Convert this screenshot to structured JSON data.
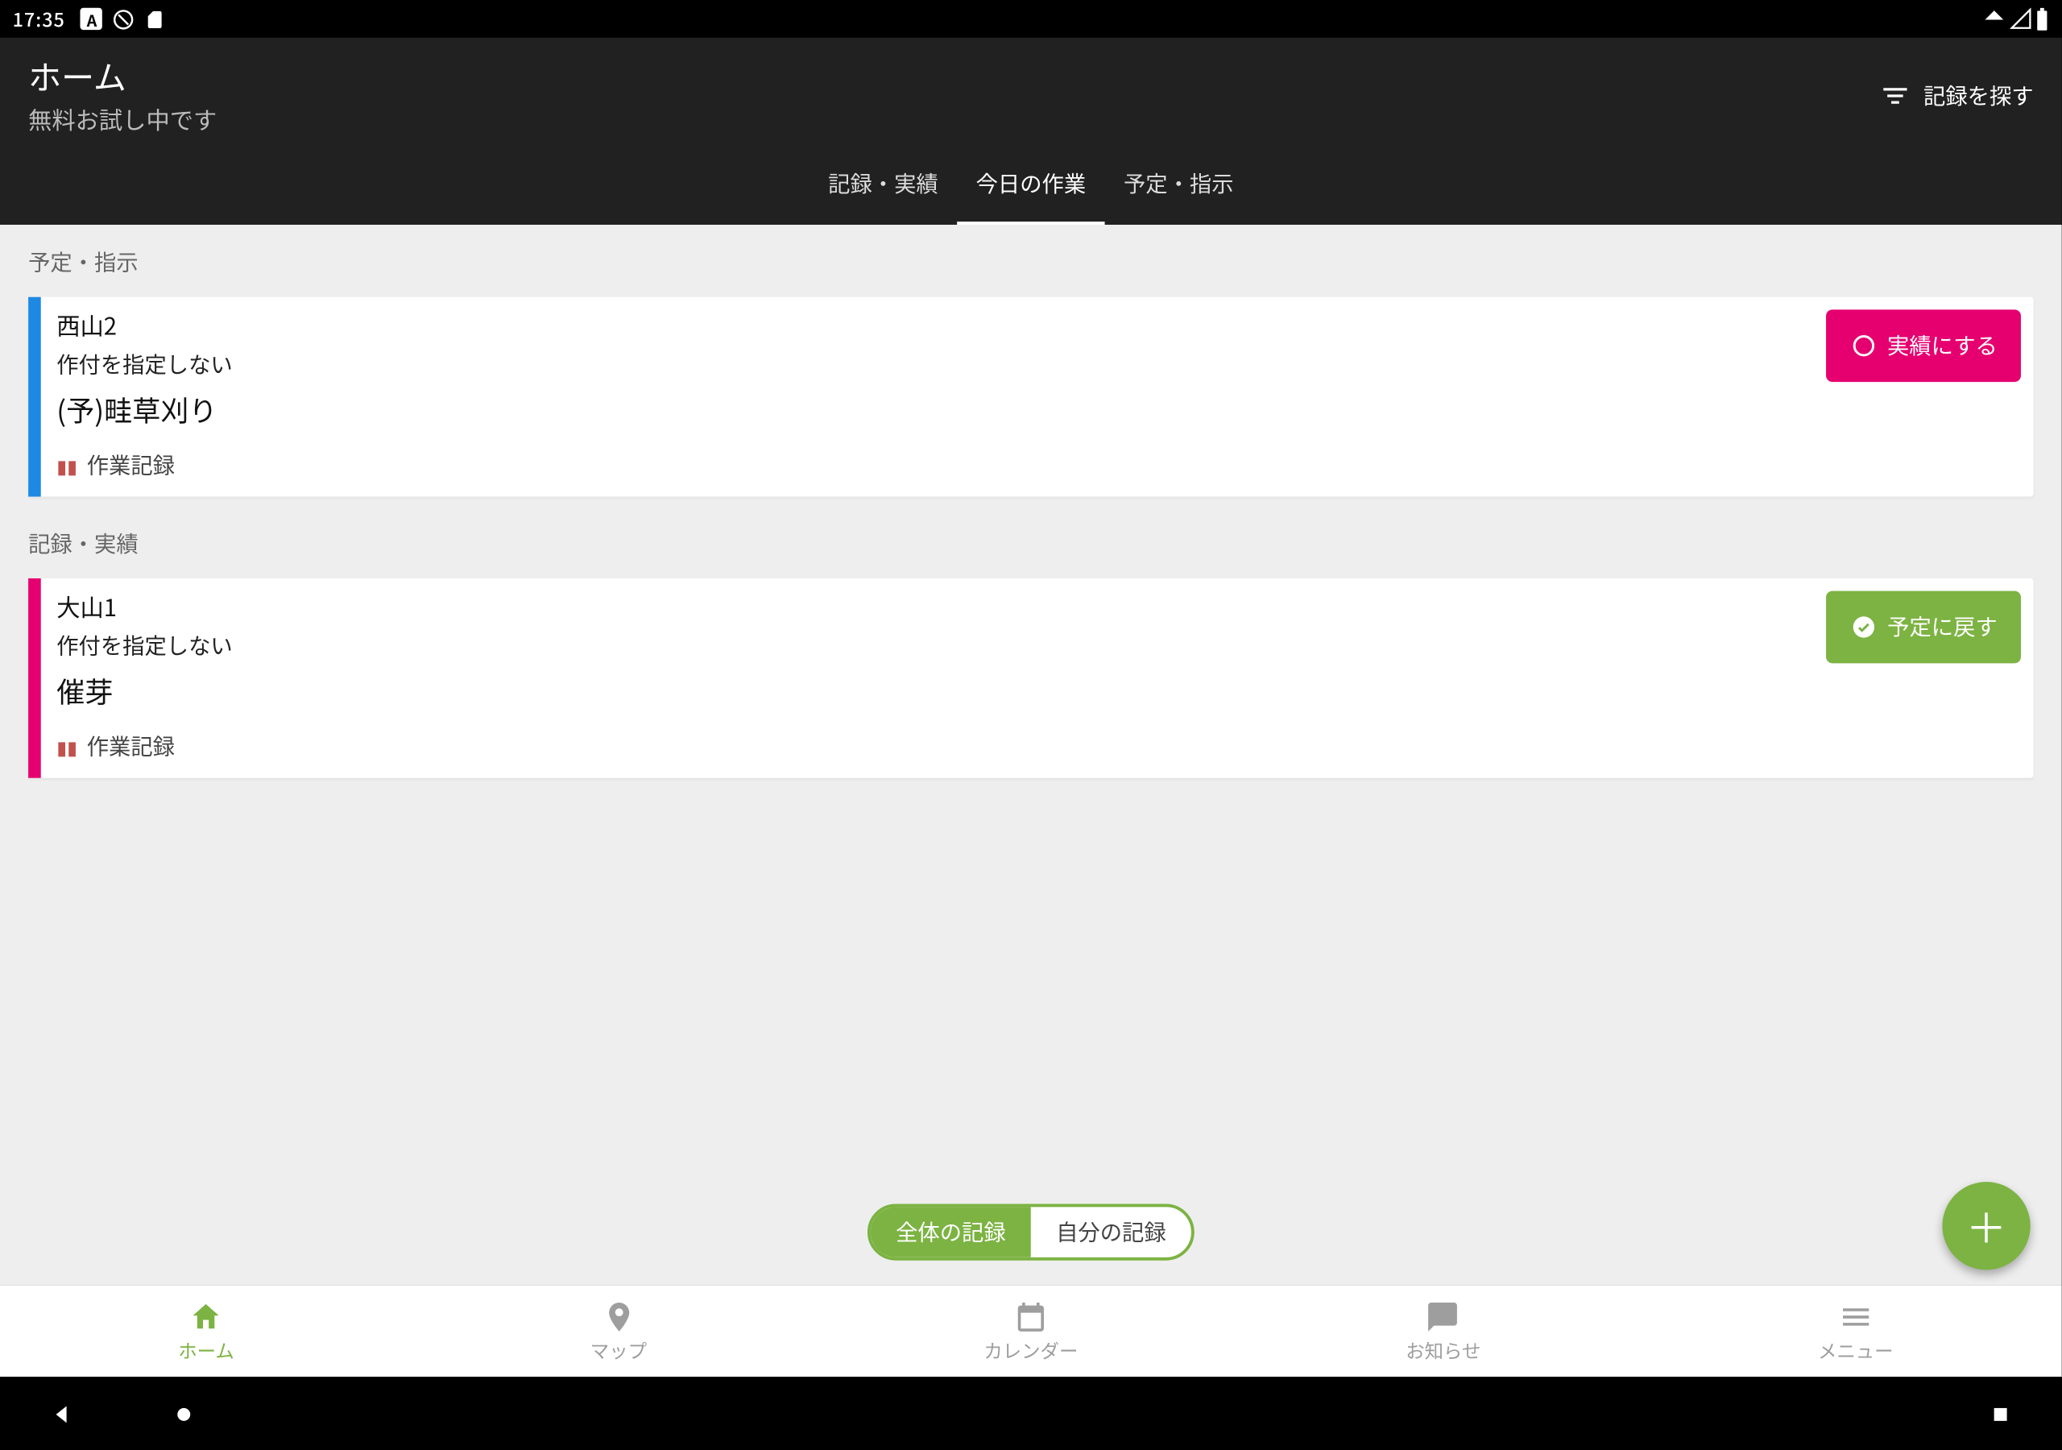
{
  "statusBar": {
    "time": "17:35"
  },
  "header": {
    "title": "ホーム",
    "subtitle": "無料お試し中です",
    "filterLabel": "記録を探す"
  },
  "tabs": {
    "records": "記録・実績",
    "today": "今日の作業",
    "plans": "予定・指示"
  },
  "sections": {
    "plansLabel": "予定・指示",
    "recordsLabel": "記録・実績"
  },
  "cards": {
    "plan": {
      "accent": "#1e88e5",
      "location": "西山2",
      "crop": "作付を指定しない",
      "task": "(予)畦草刈り",
      "tag": "作業記録",
      "actionLabel": "実績にする"
    },
    "record": {
      "accent": "#e6006f",
      "location": "大山1",
      "crop": "作付を指定しない",
      "task": "催芽",
      "tag": "作業記録",
      "actionLabel": "予定に戻す"
    }
  },
  "toggle": {
    "all": "全体の記録",
    "mine": "自分の記録"
  },
  "bottomNav": {
    "home": "ホーム",
    "map": "マップ",
    "calendar": "カレンダー",
    "notify": "お知らせ",
    "menu": "メニュー"
  }
}
